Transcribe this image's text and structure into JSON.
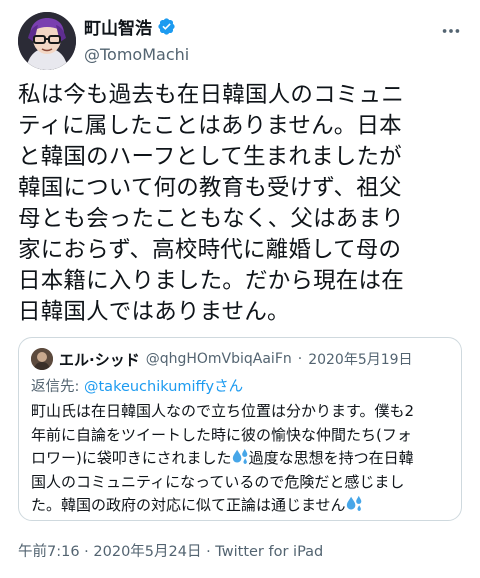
{
  "author": {
    "display_name": "町山智浩",
    "handle": "@TomoMachi",
    "verified_icon": "verified-badge-icon"
  },
  "tweet": {
    "text": "私は今も過去も在日韓国人のコミュニ\nティに属したことはありません。日本\nと韓国のハーフとして生まれましたが\n韓国について何の教育も受けず、祖父\n母とも会ったこともなく、父はあまり\n家におらず、高校時代に離婚して母の\n日本籍に入りました。だから現在は在\n日韓国人ではありません。"
  },
  "quote": {
    "display_name": "エル·シッド",
    "handle": "@qhgHOmVbiqAaiFn",
    "separator": "·",
    "date": "2020年5月19日",
    "reply_prefix": "返信先: ",
    "reply_to": "@takeuchikumiffyさん",
    "text_1": "町山氏は在日韓国人なので立ち位置は分かります。僕も2\n年前に自論をツイートした時に彼の愉快な仲間たち(フォ\nロワー)に袋叩きにされました",
    "text_2": "過度な思想を持つ在日韓\n国人のコミュニティになっているので危険だと感じまし\nた。韓国の政府の対応に似て正論は通じません",
    "emoji_icon": "sweat-droplets-icon"
  },
  "meta": {
    "time": "午前7:16",
    "separator": " · ",
    "date": "2020年5月24日",
    "separator2": " · ",
    "source": "Twitter for iPad"
  },
  "colors": {
    "accent": "#1d9bf0",
    "secondary_text": "#536471",
    "border": "#cfd9de"
  }
}
